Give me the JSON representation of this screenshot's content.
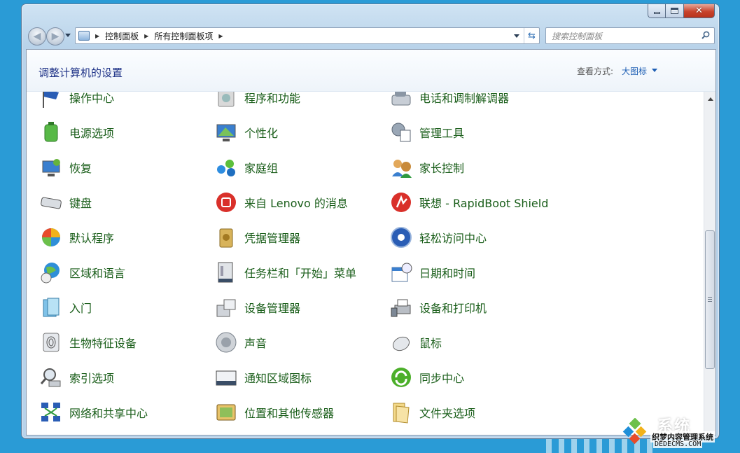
{
  "address": {
    "crumbs": [
      "控制面板",
      "所有控制面板项"
    ]
  },
  "search": {
    "placeholder": "搜索控制面板"
  },
  "header": {
    "title": "调整计算机的设置",
    "view_label": "查看方式:",
    "view_value": "大图标"
  },
  "items": [
    {
      "label": "操作中心",
      "icon": "flag-icon"
    },
    {
      "label": "程序和功能",
      "icon": "programs-icon"
    },
    {
      "label": "电话和调制解调器",
      "icon": "phone-modem-icon"
    },
    {
      "label": "电源选项",
      "icon": "battery-icon"
    },
    {
      "label": "个性化",
      "icon": "personalize-icon"
    },
    {
      "label": "管理工具",
      "icon": "admin-tools-icon"
    },
    {
      "label": "恢复",
      "icon": "recovery-icon"
    },
    {
      "label": "家庭组",
      "icon": "homegroup-icon"
    },
    {
      "label": "家长控制",
      "icon": "parental-control-icon"
    },
    {
      "label": "键盘",
      "icon": "keyboard-icon"
    },
    {
      "label": "来自 Lenovo 的消息",
      "icon": "lenovo-message-icon"
    },
    {
      "label": "联想 - RapidBoot Shield",
      "icon": "rapidboot-icon"
    },
    {
      "label": "默认程序",
      "icon": "default-programs-icon"
    },
    {
      "label": "凭据管理器",
      "icon": "credential-vault-icon"
    },
    {
      "label": "轻松访问中心",
      "icon": "ease-of-access-icon"
    },
    {
      "label": "区域和语言",
      "icon": "region-globe-icon"
    },
    {
      "label": "任务栏和「开始」菜单",
      "icon": "taskbar-icon"
    },
    {
      "label": "日期和时间",
      "icon": "calendar-clock-icon"
    },
    {
      "label": "入门",
      "icon": "getting-started-icon"
    },
    {
      "label": "设备管理器",
      "icon": "device-manager-icon"
    },
    {
      "label": "设备和打印机",
      "icon": "printer-icon"
    },
    {
      "label": "生物特征设备",
      "icon": "fingerprint-icon"
    },
    {
      "label": "声音",
      "icon": "speaker-icon"
    },
    {
      "label": "鼠标",
      "icon": "mouse-icon"
    },
    {
      "label": "索引选项",
      "icon": "magnifier-icon"
    },
    {
      "label": "通知区域图标",
      "icon": "notification-icon"
    },
    {
      "label": "同步中心",
      "icon": "sync-icon"
    },
    {
      "label": "网络和共享中心",
      "icon": "network-icon"
    },
    {
      "label": "位置和其他传感器",
      "icon": "location-sensor-icon"
    },
    {
      "label": "文件夹选项",
      "icon": "folder-icon"
    }
  ],
  "watermark": {
    "big": "系统",
    "small": "织梦内容管理系统",
    "url": "DEDECMS.COM"
  }
}
